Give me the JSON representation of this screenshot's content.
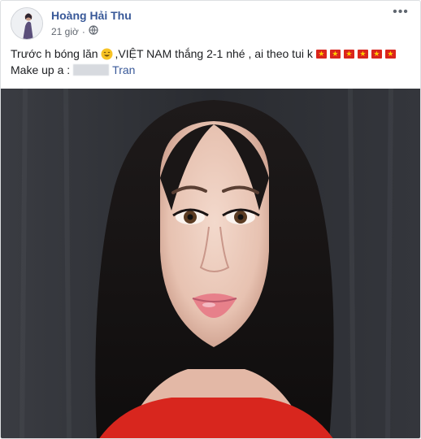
{
  "post": {
    "author_name": "Hoàng Hải Thu",
    "time": "21 giờ",
    "privacy_icon": "globe-icon",
    "more_icon": "more-options-icon",
    "more_glyph": "•••",
    "text_line1_a": "Trước h bóng lăn",
    "text_line1_b": ",VIỆT NAM thắng 2-1 nhé , ai theo tui k",
    "text_line2_a": "Make up a :",
    "mention": "Tran",
    "flag_count": 6,
    "flag_star": "★"
  },
  "colors": {
    "link": "#385898",
    "muted": "#616770",
    "flag_red": "#da251d",
    "flag_star": "#ffcd00",
    "dress_red": "#d8261e"
  }
}
